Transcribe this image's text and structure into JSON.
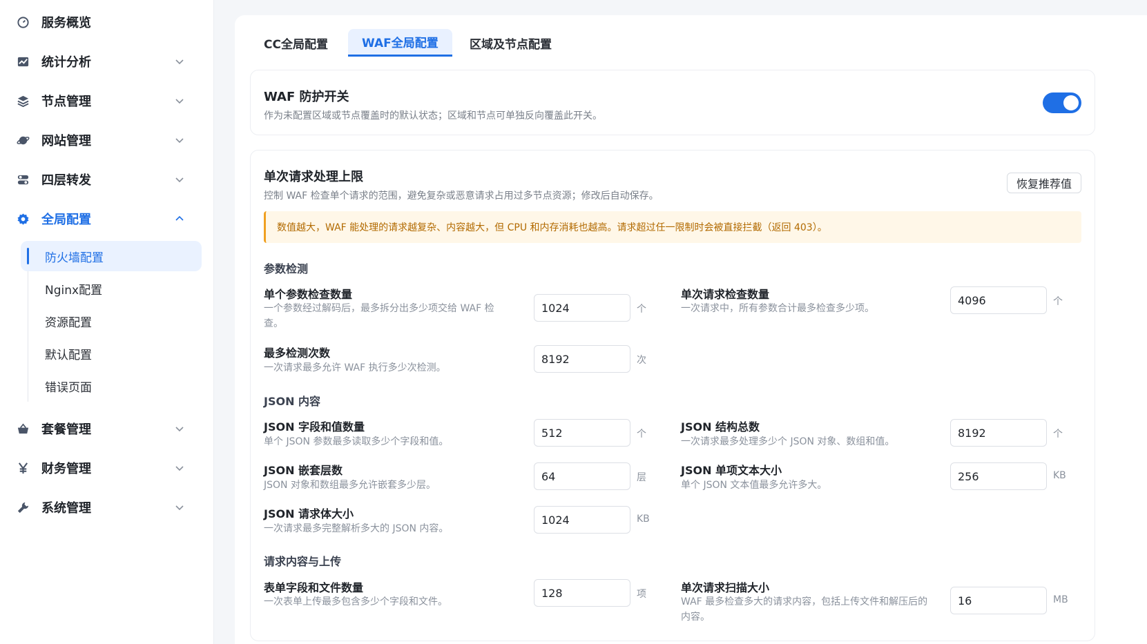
{
  "sidebar": {
    "items": [
      {
        "label": "服务概览",
        "icon": "dashboard-icon"
      },
      {
        "label": "统计分析",
        "icon": "chart-icon"
      },
      {
        "label": "节点管理",
        "icon": "layers-icon"
      },
      {
        "label": "网站管理",
        "icon": "planet-icon"
      },
      {
        "label": "四层转发",
        "icon": "toggle-icon"
      },
      {
        "label": "全局配置",
        "icon": "gear-icon",
        "active": true
      },
      {
        "label": "套餐管理",
        "icon": "basket-icon"
      },
      {
        "label": "财务管理",
        "icon": "yen-icon"
      },
      {
        "label": "系统管理",
        "icon": "wrench-icon"
      }
    ],
    "subitems": [
      {
        "label": "防火墙配置",
        "active": true
      },
      {
        "label": "Nginx配置"
      },
      {
        "label": "资源配置"
      },
      {
        "label": "默认配置"
      },
      {
        "label": "错误页面"
      }
    ]
  },
  "tabs": [
    {
      "label": "CC全局配置"
    },
    {
      "label": "WAF全局配置",
      "active": true
    },
    {
      "label": "区域及节点配置"
    }
  ],
  "waf_switch": {
    "title": "WAF 防护开关",
    "desc": "作为未配置区域或节点覆盖时的默认状态；区域和节点可单独反向覆盖此开关。",
    "enabled": true
  },
  "limits": {
    "title": "单次请求处理上限",
    "desc": "控制 WAF 检查单个请求的范围，避免复杂或恶意请求占用过多节点资源；修改后自动保存。",
    "reset_label": "恢复推荐值",
    "alert": "数值越大，WAF 能处理的请求越复杂、内容越大，但 CPU 和内存消耗也越高。请求超过任一限制时会被直接拦截（返回 403）。"
  },
  "groups": {
    "params": "参数检测",
    "json": "JSON 内容",
    "upload": "请求内容与上传"
  },
  "fields": {
    "param_count": {
      "label": "单个参数检查数量",
      "desc": "一个参数经过解码后，最多拆分出多少项交给 WAF 检查。",
      "value": "1024",
      "unit": "个"
    },
    "request_count": {
      "label": "单次请求检查数量",
      "desc": "一次请求中，所有参数合计最多检查多少项。",
      "value": "4096",
      "unit": "个"
    },
    "max_checks": {
      "label": "最多检测次数",
      "desc": "一次请求最多允许 WAF 执行多少次检测。",
      "value": "8192",
      "unit": "次"
    },
    "json_fields": {
      "label": "JSON 字段和值数量",
      "desc": "单个 JSON 参数最多读取多少个字段和值。",
      "value": "512",
      "unit": "个"
    },
    "json_total": {
      "label": "JSON 结构总数",
      "desc": "一次请求最多处理多少个 JSON 对象、数组和值。",
      "value": "8192",
      "unit": "个"
    },
    "json_depth": {
      "label": "JSON 嵌套层数",
      "desc": "JSON 对象和数组最多允许嵌套多少层。",
      "value": "64",
      "unit": "层"
    },
    "json_text": {
      "label": "JSON 单项文本大小",
      "desc": "单个 JSON 文本值最多允许多大。",
      "value": "256",
      "unit": "KB"
    },
    "json_body": {
      "label": "JSON 请求体大小",
      "desc": "一次请求最多完整解析多大的 JSON 内容。",
      "value": "1024",
      "unit": "KB"
    },
    "form_count": {
      "label": "表单字段和文件数量",
      "desc": "一次表单上传最多包含多少个字段和文件。",
      "value": "128",
      "unit": "项"
    },
    "scan_size": {
      "label": "单次请求扫描大小",
      "desc": "WAF 最多检查多大的请求内容，包括上传文件和解压后的内容。",
      "value": "16",
      "unit": "MB"
    }
  }
}
